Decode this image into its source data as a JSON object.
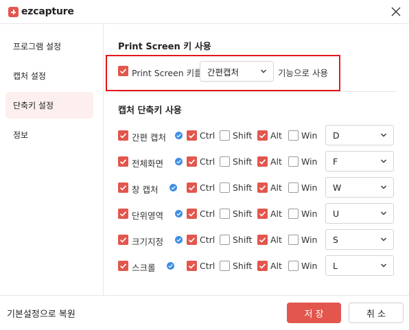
{
  "app": {
    "logo_text": "ezcapture"
  },
  "sidebar": {
    "items": [
      {
        "label": "프로그램 설정"
      },
      {
        "label": "캡처 설정"
      },
      {
        "label": "단축키 설정"
      },
      {
        "label": "정보"
      }
    ],
    "active_index": 2
  },
  "print_screen": {
    "title": "Print Screen 키 사용",
    "checkbox_label": "Print Screen 키를",
    "checked": true,
    "selected_option": "간편캡처",
    "suffix": "기능으로 사용"
  },
  "shortcuts": {
    "title": "캡처 단축키 사용",
    "modifier_labels": {
      "ctrl": "Ctrl",
      "shift": "Shift",
      "alt": "Alt",
      "win": "Win"
    },
    "rows": [
      {
        "name": "간편 캡처",
        "enabled": true,
        "ctrl": true,
        "shift": false,
        "alt": true,
        "win": false,
        "key": "D"
      },
      {
        "name": "전체화면",
        "enabled": true,
        "ctrl": true,
        "shift": false,
        "alt": true,
        "win": false,
        "key": "F"
      },
      {
        "name": "창 캡처",
        "enabled": true,
        "ctrl": true,
        "shift": false,
        "alt": true,
        "win": false,
        "key": "W"
      },
      {
        "name": "단위영역",
        "enabled": true,
        "ctrl": true,
        "shift": false,
        "alt": true,
        "win": false,
        "key": "U"
      },
      {
        "name": "크기지정",
        "enabled": true,
        "ctrl": true,
        "shift": false,
        "alt": true,
        "win": false,
        "key": "S"
      },
      {
        "name": "스크롤",
        "enabled": true,
        "ctrl": true,
        "shift": false,
        "alt": true,
        "win": false,
        "key": "L"
      }
    ]
  },
  "footer": {
    "restore_label": "기본설정으로 복원",
    "save_label": "저 장",
    "cancel_label": "취 소"
  },
  "colors": {
    "accent": "#e2564d",
    "highlight_box": "#e5141b",
    "verified_badge": "#3f8ee6",
    "active_sidebar_bg": "#fcefee"
  }
}
